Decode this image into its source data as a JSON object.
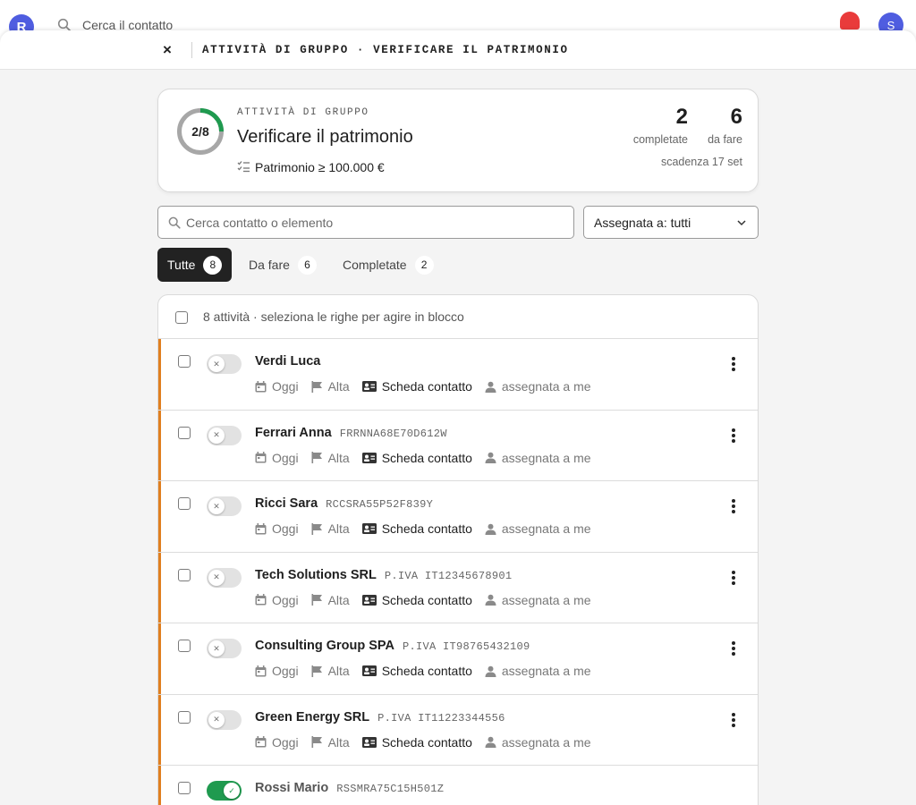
{
  "app": {
    "logo_letter": "R",
    "search_placeholder": "Cerca il contatto",
    "avatar_initial": "S"
  },
  "header": {
    "close_label": "×",
    "title": "ATTIVITÀ DI GRUPPO · VERIFICARE IL PATRIMONIO"
  },
  "summary": {
    "progress_text": "2/8",
    "progress_done": 2,
    "progress_total": 8,
    "eyebrow": "ATTIVITÀ DI GRUPPO",
    "title": "Verificare il patrimonio",
    "criteria": "Patrimonio ≥ 100.000 €",
    "completed_count": "2",
    "completed_label": "completate",
    "todo_count": "6",
    "todo_label": "da fare",
    "deadline": "scadenza 17 set"
  },
  "controls": {
    "search_placeholder": "Cerca contatto o elemento",
    "filter_label": "Assegnata a: tutti"
  },
  "tabs": [
    {
      "label": "Tutte",
      "count": "8"
    },
    {
      "label": "Da fare",
      "count": "6"
    },
    {
      "label": "Completate",
      "count": "2"
    }
  ],
  "list": {
    "summary": "8 attività · seleziona le righe per agire in blocco"
  },
  "rows": [
    {
      "name": "Verdi Luca",
      "code": "",
      "due": "Oggi",
      "priority": "Alta",
      "link": "Scheda contatto",
      "assignee": "assegnata a me"
    },
    {
      "name": "Ferrari Anna",
      "code": "FRRNNA68E70D612W",
      "due": "Oggi",
      "priority": "Alta",
      "link": "Scheda contatto",
      "assignee": "assegnata a me"
    },
    {
      "name": "Ricci Sara",
      "code": "RCCSRA55P52F839Y",
      "due": "Oggi",
      "priority": "Alta",
      "link": "Scheda contatto",
      "assignee": "assegnata a me"
    },
    {
      "name": "Tech Solutions SRL",
      "code": "P.IVA IT12345678901",
      "due": "Oggi",
      "priority": "Alta",
      "link": "Scheda contatto",
      "assignee": "assegnata a me"
    },
    {
      "name": "Consulting Group SPA",
      "code": "P.IVA IT98765432109",
      "due": "Oggi",
      "priority": "Alta",
      "link": "Scheda contatto",
      "assignee": "assegnata a me"
    },
    {
      "name": "Green Energy SRL",
      "code": "P.IVA IT11223344556",
      "due": "Oggi",
      "priority": "Alta",
      "link": "Scheda contatto",
      "assignee": "assegnata a me"
    },
    {
      "name": "Rossi Mario",
      "code": "RSSMRA75C15H501Z",
      "due": "",
      "priority": "",
      "link": "",
      "assignee": ""
    }
  ],
  "colors": {
    "accent": "#e07f1f",
    "done": "#1f9a4f",
    "progress_track": "#a7a7a7",
    "notification": "#e93b3b",
    "brand": "#4f5de0"
  }
}
